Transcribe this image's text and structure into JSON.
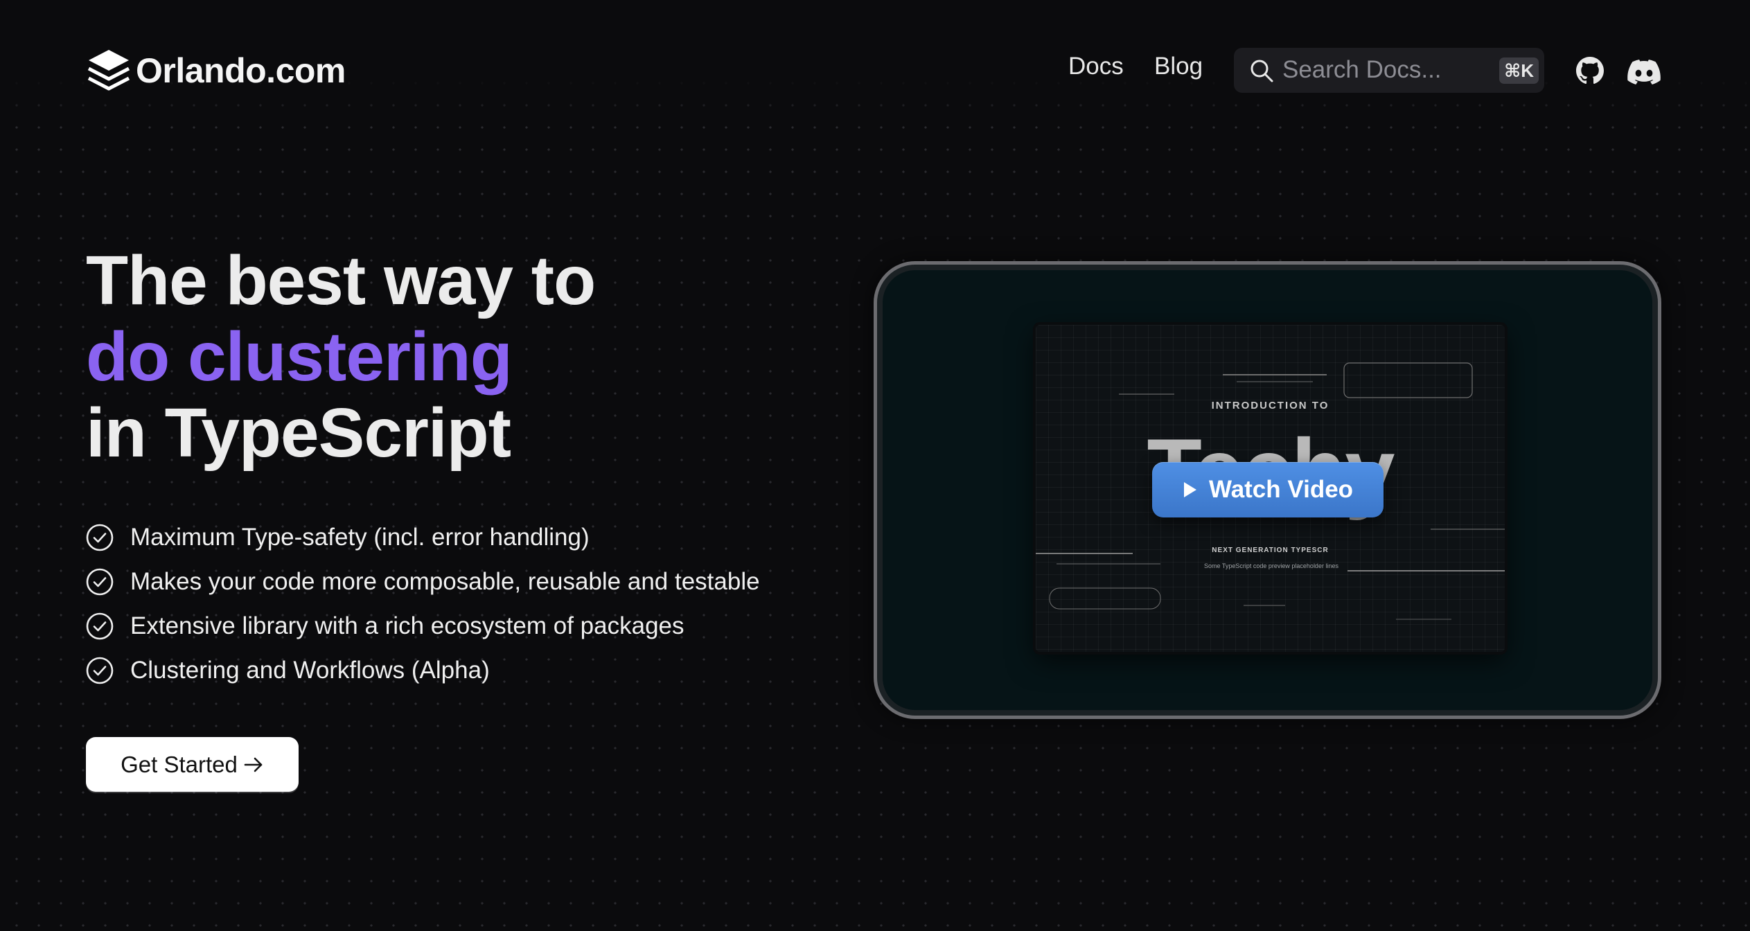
{
  "header": {
    "brand": "Orlando.com",
    "nav": [
      {
        "label": "Docs"
      },
      {
        "label": "Blog"
      }
    ],
    "search": {
      "placeholder": "Search Docs...",
      "shortcut": "⌘K"
    },
    "icons": [
      "github-icon",
      "discord-icon"
    ]
  },
  "hero": {
    "title_lines": [
      "The best way to",
      "do clustering",
      "in TypeScript"
    ],
    "features": [
      "Maximum Type-safety (incl. error handling)",
      "Makes your code more composable, reusable and testable",
      "Extensive library with a rich ecosystem of packages",
      "Clustering and Workflows (Alpha)"
    ],
    "cta_label": "Get Started"
  },
  "video": {
    "thumbnail_intro": "INTRODUCTION TO",
    "thumbnail_title": "Techy",
    "thumbnail_subtitle": "NEXT GENERATION TYPESCR",
    "thumbnail_desc": "Some TypeScript code preview placeholder lines",
    "watch_label": "Watch Video"
  },
  "colors": {
    "background": "#0b0b0d",
    "accent": "#8a63f1",
    "watch_button": "#4684d6",
    "frame": "#061417"
  }
}
